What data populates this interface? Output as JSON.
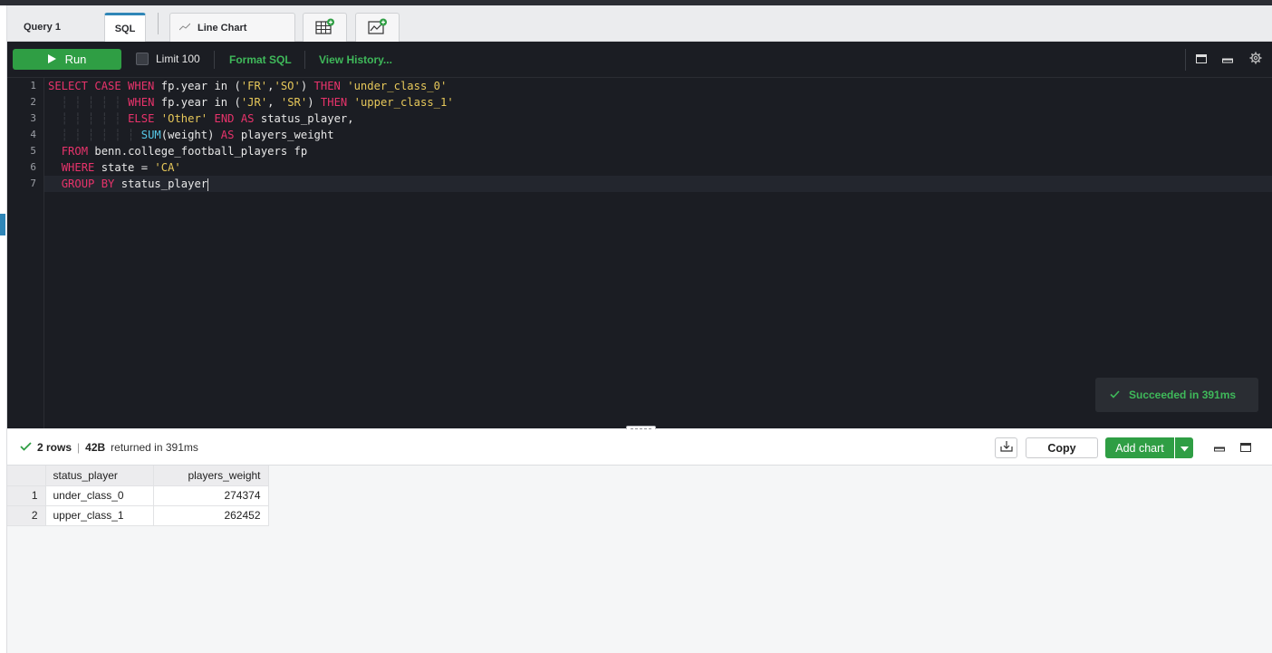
{
  "tabs": {
    "query_label": "Query 1",
    "sql_label": "SQL",
    "line_chart_label": "Line Chart",
    "add_table_icon": "table-plus-icon",
    "add_chart_icon": "chart-plus-icon"
  },
  "toolbar": {
    "run_label": "Run",
    "limit_label": "Limit 100",
    "format_label": "Format SQL",
    "history_label": "View History..."
  },
  "editor": {
    "line_numbers": [
      "1",
      "2",
      "3",
      "4",
      "5",
      "6",
      "7"
    ]
  },
  "toast": {
    "text": "Succeeded in 391ms"
  },
  "results": {
    "rows_count": "2 rows",
    "size": "42B",
    "returned_text": "returned in 391ms",
    "copy_label": "Copy",
    "add_chart_label": "Add chart",
    "columns": [
      "status_player",
      "players_weight"
    ],
    "rows": [
      {
        "index": "1",
        "status_player": "under_class_0",
        "players_weight": "274374"
      },
      {
        "index": "2",
        "status_player": "upper_class_1",
        "players_weight": "262452"
      }
    ]
  },
  "colors": {
    "accent_green": "#2f9e44",
    "keyword": "#e8336b",
    "string": "#e7c85a",
    "function": "#56c7e6",
    "editor_bg": "#1b1d23"
  }
}
